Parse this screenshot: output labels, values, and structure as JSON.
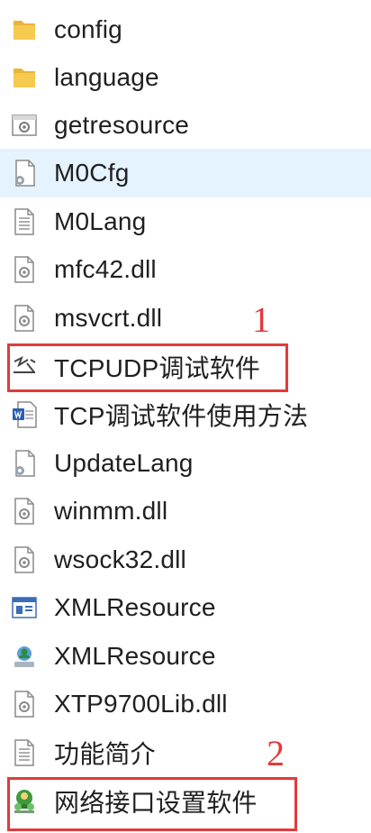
{
  "colors": {
    "selected_bg": "#e5f3ff",
    "annotation": "#e23a3a",
    "folder": "#f4c34c"
  },
  "files": [
    {
      "name": "config",
      "icon": "folder-icon",
      "selected": false
    },
    {
      "name": "language",
      "icon": "folder-icon",
      "selected": false
    },
    {
      "name": "getresource",
      "icon": "config-file-icon",
      "selected": false
    },
    {
      "name": "M0Cfg",
      "icon": "settings-file-icon",
      "selected": true
    },
    {
      "name": "M0Lang",
      "icon": "text-file-icon",
      "selected": false
    },
    {
      "name": "mfc42.dll",
      "icon": "dll-file-icon",
      "selected": false
    },
    {
      "name": "msvcrt.dll",
      "icon": "dll-file-icon",
      "selected": false
    },
    {
      "name": "TCPUDP调试软件",
      "icon": "tcpudp-app-icon",
      "selected": false
    },
    {
      "name": "TCP调试软件使用方法",
      "icon": "word-document-icon",
      "selected": false
    },
    {
      "name": "UpdateLang",
      "icon": "settings-file-icon",
      "selected": false
    },
    {
      "name": "winmm.dll",
      "icon": "dll-file-icon",
      "selected": false
    },
    {
      "name": "wsock32.dll",
      "icon": "dll-file-icon",
      "selected": false
    },
    {
      "name": "XMLResource",
      "icon": "window-app-icon",
      "selected": false
    },
    {
      "name": "XMLResource",
      "icon": "network-app-icon",
      "selected": false
    },
    {
      "name": "XTP9700Lib.dll",
      "icon": "dll-file-icon",
      "selected": false
    },
    {
      "name": "功能简介",
      "icon": "text-file-icon",
      "selected": false
    },
    {
      "name": "网络接口设置软件",
      "icon": "network-config-app-icon",
      "selected": false
    }
  ],
  "annotations": [
    {
      "label": "1"
    },
    {
      "label": "2"
    }
  ]
}
